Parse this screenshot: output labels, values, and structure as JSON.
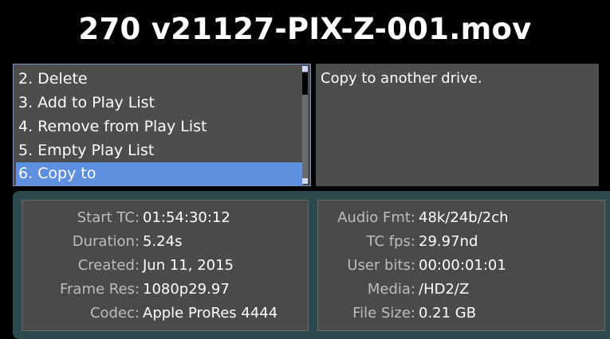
{
  "title": "270 v21127-PIX-Z-001.mov",
  "menu": {
    "items": [
      {
        "label": "2. Delete"
      },
      {
        "label": "3. Add to Play List"
      },
      {
        "label": "4. Remove from Play List"
      },
      {
        "label": "5. Empty Play List"
      },
      {
        "label": "6. Copy to"
      }
    ],
    "selected_index": 4
  },
  "description": "Copy to another drive.",
  "info_left": [
    {
      "label": "Start TC:",
      "value": "01:54:30:12"
    },
    {
      "label": "Duration:",
      "value": "5.24s"
    },
    {
      "label": "Created:",
      "value": "Jun 11, 2015"
    },
    {
      "label": "Frame Res:",
      "value": "1080p29.97"
    },
    {
      "label": "Codec:",
      "value": "Apple ProRes 4444"
    }
  ],
  "info_right": [
    {
      "label": "Audio Fmt:",
      "value": "48k/24b/2ch"
    },
    {
      "label": "TC fps:",
      "value": "29.97nd"
    },
    {
      "label": "User bits:",
      "value": "00:00:01:01"
    },
    {
      "label": "Media:",
      "value": "/HD2/Z"
    },
    {
      "label": "File Size:",
      "value": "0.21 GB"
    }
  ],
  "colors": {
    "background": "#000000",
    "panel": "#4d4d4d",
    "selection": "#5f8fdf",
    "info_frame": "#2c4a4e"
  }
}
